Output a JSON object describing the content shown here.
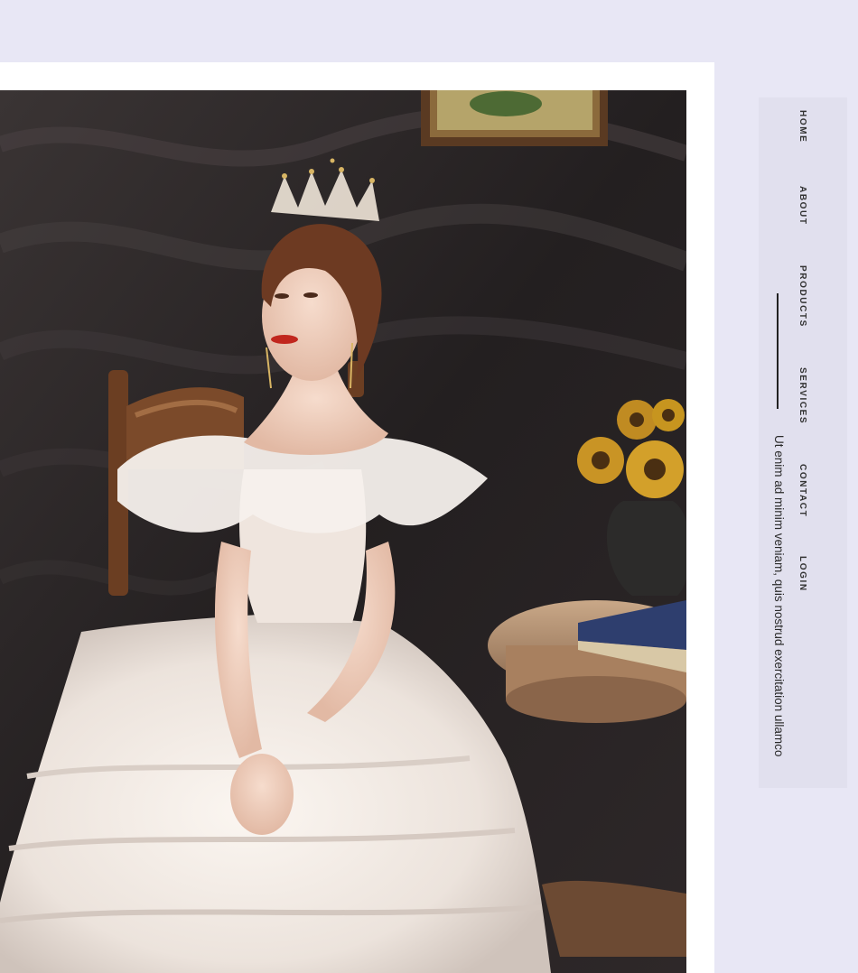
{
  "nav": {
    "items": [
      {
        "label": "HOME"
      },
      {
        "label": "ABOUT"
      },
      {
        "label": "PRODUCTS"
      },
      {
        "label": "SERVICES"
      },
      {
        "label": "CONTACT"
      },
      {
        "label": "LOGIN"
      }
    ]
  },
  "tagline": "Ut enim ad minim veniam, quis nostrud exercitation ullamco",
  "colors": {
    "page_background": "#e8e7f5",
    "side_panel": "#e1e0ee",
    "card": "#ffffff",
    "nav_text": "#333333"
  }
}
